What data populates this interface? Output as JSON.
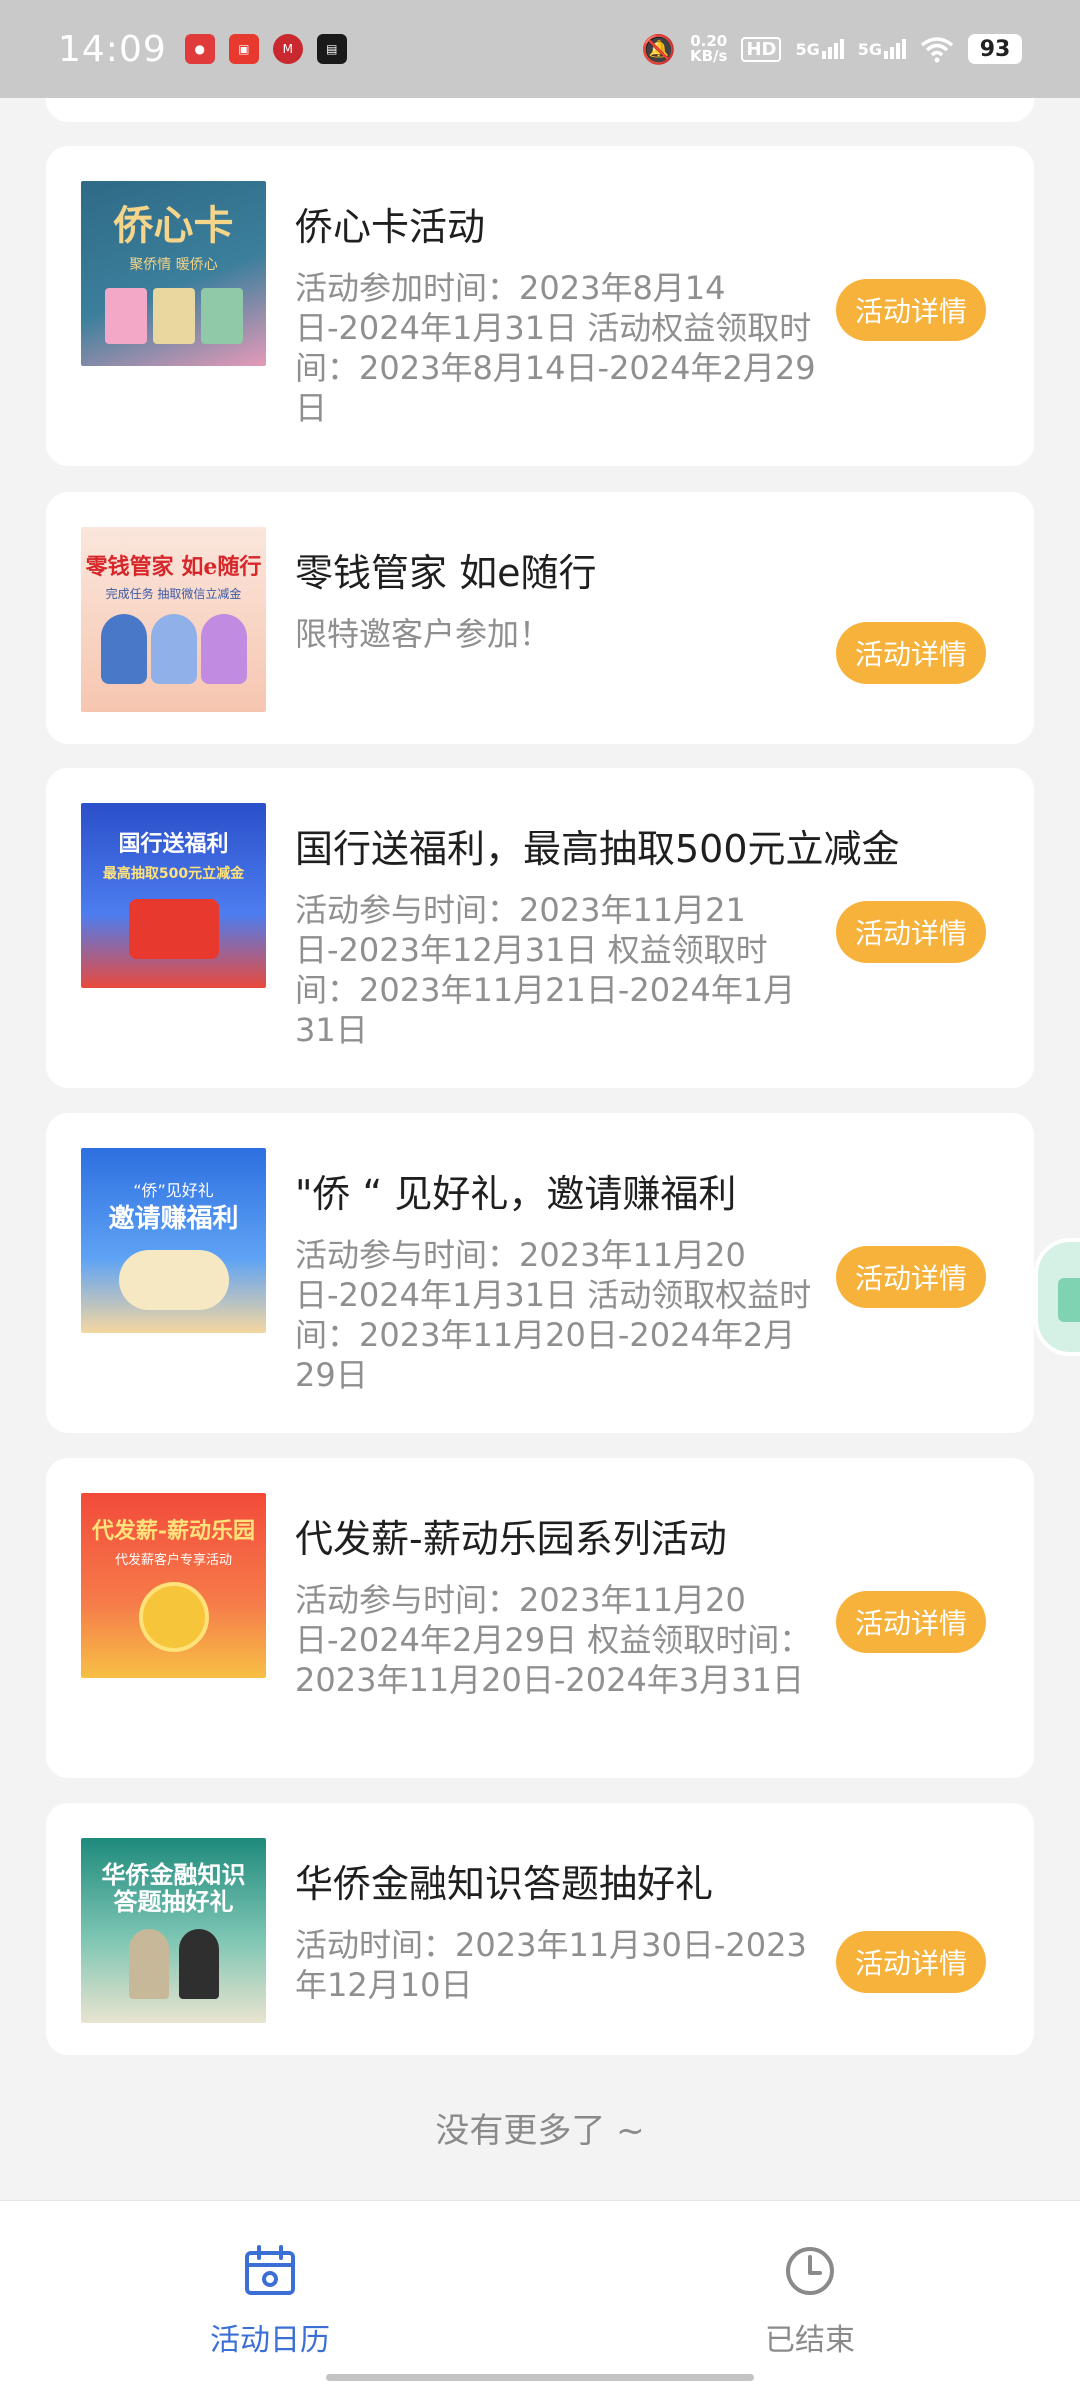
{
  "status_bar": {
    "time": "14:09",
    "net_speed_value": "0.20",
    "net_speed_unit": "KB/s",
    "hd_label": "HD",
    "signal1": "5G",
    "signal2": "5G",
    "battery": "93"
  },
  "cards": [
    {
      "title": "侨心卡活动",
      "desc": "活动参加时间：2023年8月14日-2024年1月31日 活动权益领取时间：2023年8月14日-2024年2月29日",
      "button": "活动详情",
      "thumb_title": "侨心卡",
      "thumb_sub": "聚侨情 暖侨心"
    },
    {
      "title": "零钱管家 如e随行",
      "desc": "限特邀客户参加！",
      "button": "活动详情",
      "thumb_title": "零钱管家 如e随行",
      "thumb_sub": "完成任务 抽取微信立减金"
    },
    {
      "title": "国行送福利，最高抽取500元立减金",
      "desc": "活动参与时间：2023年11月21日-2023年12月31日 权益领取时间：2023年11月21日-2024年1月31日",
      "button": "活动详情",
      "thumb_title": "国行送福利",
      "thumb_sub": "最高抽取500元立减金"
    },
    {
      "title": "\"侨 “ 见好礼，邀请赚福利",
      "desc": "活动参与时间：2023年11月20日-2024年1月31日 活动领取权益时间：2023年11月20日-2024年2月29日",
      "button": "活动详情",
      "thumb_title": "邀请赚福利",
      "thumb_sub": "“侨”见好礼"
    },
    {
      "title": "代发薪-薪动乐园系列活动",
      "desc": "活动参与时间：2023年11月20日-2024年2月29日 权益领取时间：2023年11月20日-2024年3月31日",
      "button": "活动详情",
      "thumb_title": "代发薪-薪动乐园",
      "thumb_sub": "代发薪客户专享活动"
    },
    {
      "title": "华侨金融知识答题抽好礼",
      "desc": "活动时间：2023年11月30日-2023年12月10日",
      "button": "活动详情",
      "thumb_title": "华侨金融知识答题抽好礼",
      "thumb_sub": ""
    }
  ],
  "no_more_text": "没有更多了 ~",
  "bottom_nav": {
    "calendar_label": "活动日历",
    "ended_label": "已结束"
  },
  "colors": {
    "accent_orange": "#f7b23b",
    "nav_active_blue": "#3b6fd6",
    "nav_inactive_gray": "#8a8a8a",
    "background": "#f3f3f3"
  }
}
